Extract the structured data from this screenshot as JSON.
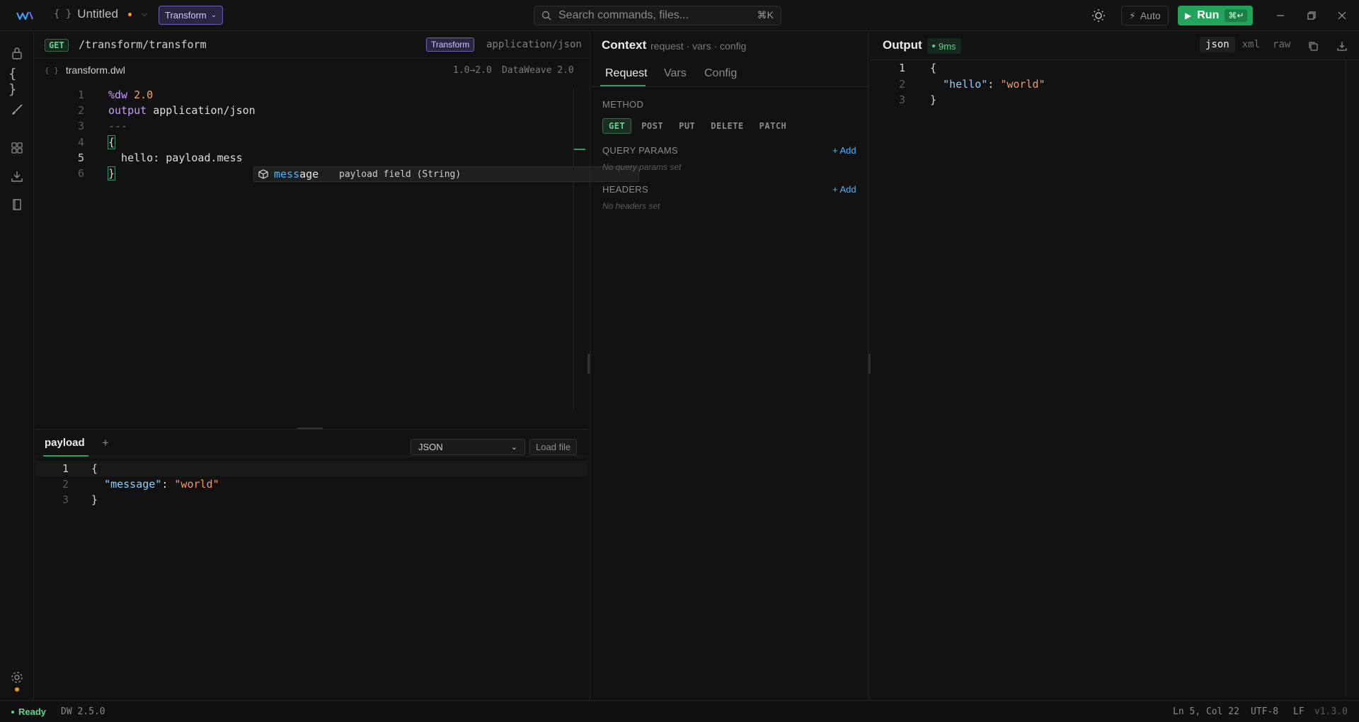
{
  "titlebar": {
    "file_name": "Untitled",
    "mode": "Transform",
    "search_placeholder": "Search commands, files...",
    "search_shortcut": "⌘K",
    "auto_label": "Auto",
    "run_label": "Run",
    "run_shortcut": "⌘↵"
  },
  "editor": {
    "method": "GET",
    "route": "/transform/transform",
    "mode_tag": "Transform",
    "content_type": "application/json",
    "file_name": "transform.dwl",
    "version": "1.0→2.0",
    "language": "DataWeave 2.0",
    "lines": [
      {
        "n": "1",
        "parts": [
          [
            "kw",
            "%dw "
          ],
          [
            "num",
            "2.0"
          ]
        ]
      },
      {
        "n": "2",
        "parts": [
          [
            "kw",
            "output "
          ],
          [
            "plain",
            "application/json"
          ]
        ]
      },
      {
        "n": "3",
        "parts": [
          [
            "muted",
            "---"
          ]
        ]
      },
      {
        "n": "4",
        "parts": [
          [
            "brace",
            "{"
          ]
        ]
      },
      {
        "n": "5",
        "parts": [
          [
            "plain",
            "  hello: payload.mess"
          ]
        ]
      },
      {
        "n": "6",
        "parts": [
          [
            "brace",
            "}"
          ]
        ]
      }
    ],
    "suggestion": {
      "match": "mess",
      "rest": "age",
      "detail": "payload field (String)"
    }
  },
  "payload": {
    "tab": "payload",
    "add_label": "+",
    "format": "JSON",
    "load_label": "Load file",
    "lines": [
      {
        "n": "1",
        "parts": [
          [
            "brace",
            "{"
          ]
        ]
      },
      {
        "n": "2",
        "parts": [
          [
            "plain",
            "  "
          ],
          [
            "key",
            "\"message\""
          ],
          [
            "plain",
            ": "
          ],
          [
            "str",
            "\"world\""
          ]
        ]
      },
      {
        "n": "3",
        "parts": [
          [
            "brace",
            "}"
          ]
        ]
      }
    ]
  },
  "context": {
    "title": "Context",
    "subtitle": "request · vars · config",
    "tabs": [
      "Request",
      "Vars",
      "Config"
    ],
    "method_label": "METHOD",
    "methods": [
      "GET",
      "POST",
      "PUT",
      "DELETE",
      "PATCH"
    ],
    "query_label": "QUERY PARAMS",
    "query_empty": "No query params set",
    "headers_label": "HEADERS",
    "headers_empty": "No headers set",
    "add_label": "+ Add"
  },
  "output": {
    "title": "Output",
    "timing": "9ms",
    "formats": [
      "json",
      "xml",
      "raw"
    ],
    "lines": [
      {
        "n": "1",
        "parts": [
          [
            "brace",
            "{"
          ]
        ]
      },
      {
        "n": "2",
        "parts": [
          [
            "plain",
            "  "
          ],
          [
            "key",
            "\"hello\""
          ],
          [
            "plain",
            ": "
          ],
          [
            "str",
            "\"world\""
          ]
        ]
      },
      {
        "n": "3",
        "parts": [
          [
            "brace",
            "}"
          ]
        ]
      }
    ]
  },
  "statusbar": {
    "status": "Ready",
    "dw_version": "DW 2.5.0",
    "cursor": "Ln 5, Col 22",
    "encoding": "UTF-8",
    "eol": "LF",
    "app_version": "v1.3.0"
  },
  "colors": {
    "accent_green": "#22a55a",
    "accent_purple": "#6f5fb4",
    "link_blue": "#4fb4ff"
  }
}
